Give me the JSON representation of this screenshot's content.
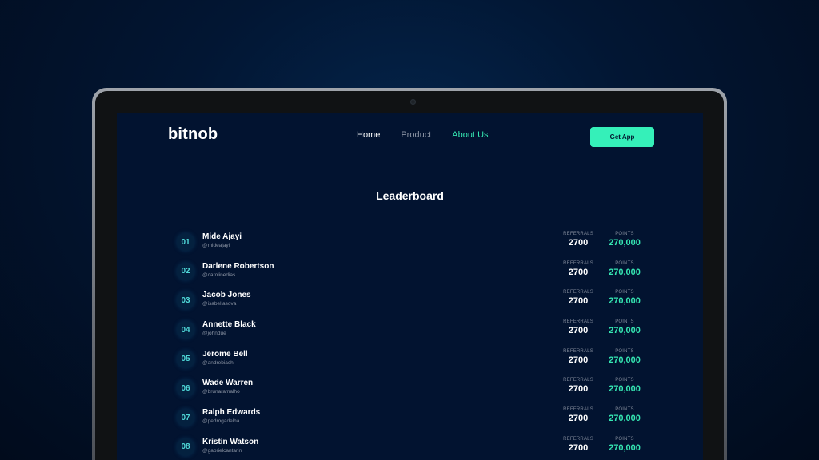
{
  "nav": {
    "logo": "bitnob",
    "links": [
      "Home",
      "Product",
      "About Us"
    ],
    "cta": "Get App"
  },
  "title": "Leaderboard",
  "labels": {
    "referrals": "REFERRALS",
    "points": "POINTS"
  },
  "rows": [
    {
      "rank": "01",
      "name": "Mide Ajayi",
      "handle": "@mideajayi",
      "referrals": "2700",
      "points": "270,000"
    },
    {
      "rank": "02",
      "name": "Darlene Robertson",
      "handle": "@carolinedias",
      "referrals": "2700",
      "points": "270,000"
    },
    {
      "rank": "03",
      "name": "Jacob Jones",
      "handle": "@isabellasova",
      "referrals": "2700",
      "points": "270,000"
    },
    {
      "rank": "04",
      "name": "Annette Black",
      "handle": "@johndue",
      "referrals": "2700",
      "points": "270,000"
    },
    {
      "rank": "05",
      "name": "Jerome Bell",
      "handle": "@andrebiachi",
      "referrals": "2700",
      "points": "270,000"
    },
    {
      "rank": "06",
      "name": "Wade Warren",
      "handle": "@brunaramalho",
      "referrals": "2700",
      "points": "270,000"
    },
    {
      "rank": "07",
      "name": "Ralph Edwards",
      "handle": "@pedrogadelha",
      "referrals": "2700",
      "points": "270,000"
    },
    {
      "rank": "08",
      "name": "Kristin Watson",
      "handle": "@gabrielcantarin",
      "referrals": "2700",
      "points": "270,000"
    }
  ],
  "colors": {
    "accent": "#35e6b2",
    "background": "#021330"
  }
}
